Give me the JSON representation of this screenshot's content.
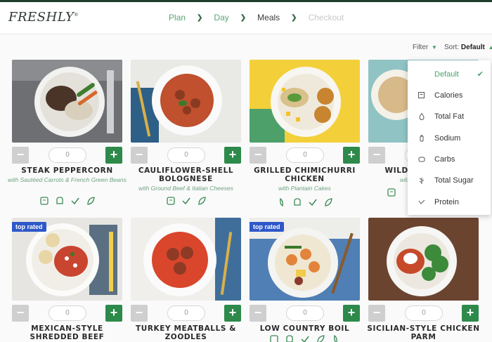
{
  "brand": {
    "name": "FRESHLY",
    "mark": "®"
  },
  "steps": [
    {
      "label": "Plan",
      "state": "done"
    },
    {
      "label": "Day",
      "state": "done"
    },
    {
      "label": "Meals",
      "state": "active"
    },
    {
      "label": "Checkout",
      "state": "disabled"
    }
  ],
  "toolbar": {
    "filter_label": "Filter",
    "sort_prefix": "Sort:",
    "sort_value": "Default"
  },
  "sort_menu": {
    "items": [
      {
        "label": "Default",
        "icon": "check-icon",
        "selected": true
      },
      {
        "label": "Calories",
        "icon": "calories-icon",
        "selected": false
      },
      {
        "label": "Total Fat",
        "icon": "fat-drop-icon",
        "selected": false
      },
      {
        "label": "Sodium",
        "icon": "salt-shaker-icon",
        "selected": false
      },
      {
        "label": "Carbs",
        "icon": "carbs-icon",
        "selected": false
      },
      {
        "label": "Total Sugar",
        "icon": "sugar-cane-icon",
        "selected": false
      },
      {
        "label": "Protein",
        "icon": "protein-icon",
        "selected": false
      }
    ]
  },
  "meals": [
    {
      "title": "STEAK PEPPERCORN",
      "subtitle": "with Sautéed Carrots & French Green Beans",
      "quantity": "0",
      "badge": "",
      "icons": [
        "calorie-icon",
        "sodium-icon",
        "check-mark-icon",
        "leaf-icon"
      ]
    },
    {
      "title": "CAULIFLOWER-SHELL BOLOGNESE",
      "subtitle": "with Ground Beef & Italian Cheeses",
      "quantity": "0",
      "badge": "",
      "icons": [
        "calorie-icon",
        "check-mark-icon",
        "leaf-icon"
      ]
    },
    {
      "title": "GRILLED CHIMICHURRI CHICKEN",
      "subtitle": "with Plantain Cakes",
      "quantity": "0",
      "badge": "",
      "icons": [
        "pepper-icon",
        "sodium-icon",
        "check-mark-icon",
        "leaf-icon"
      ]
    },
    {
      "title": "WILD-",
      "subtitle": "with",
      "quantity": "0",
      "badge": "",
      "icons": [
        "calorie-icon"
      ]
    },
    {
      "title": "MEXICAN-STYLE SHREDDED BEEF",
      "subtitle": "",
      "quantity": "0",
      "badge": "top rated",
      "icons": []
    },
    {
      "title": "TURKEY MEATBALLS & ZOODLES",
      "subtitle": "",
      "quantity": "0",
      "badge": "",
      "icons": []
    },
    {
      "title": "LOW COUNTRY BOIL",
      "subtitle": "",
      "quantity": "0",
      "badge": "top rated",
      "icons": [
        "calorie-icon",
        "sodium-icon",
        "check-mark-icon",
        "leaf-icon",
        "pepper-icon"
      ]
    },
    {
      "title": "SICILIAN-STYLE CHICKEN PARM",
      "subtitle": "",
      "quantity": "0",
      "badge": "",
      "icons": []
    }
  ],
  "colors": {
    "accent_green": "#2d8a4a",
    "link_green": "#5aa575",
    "badge_blue": "#2e58c9",
    "header_bar": "#1f3d2b"
  }
}
